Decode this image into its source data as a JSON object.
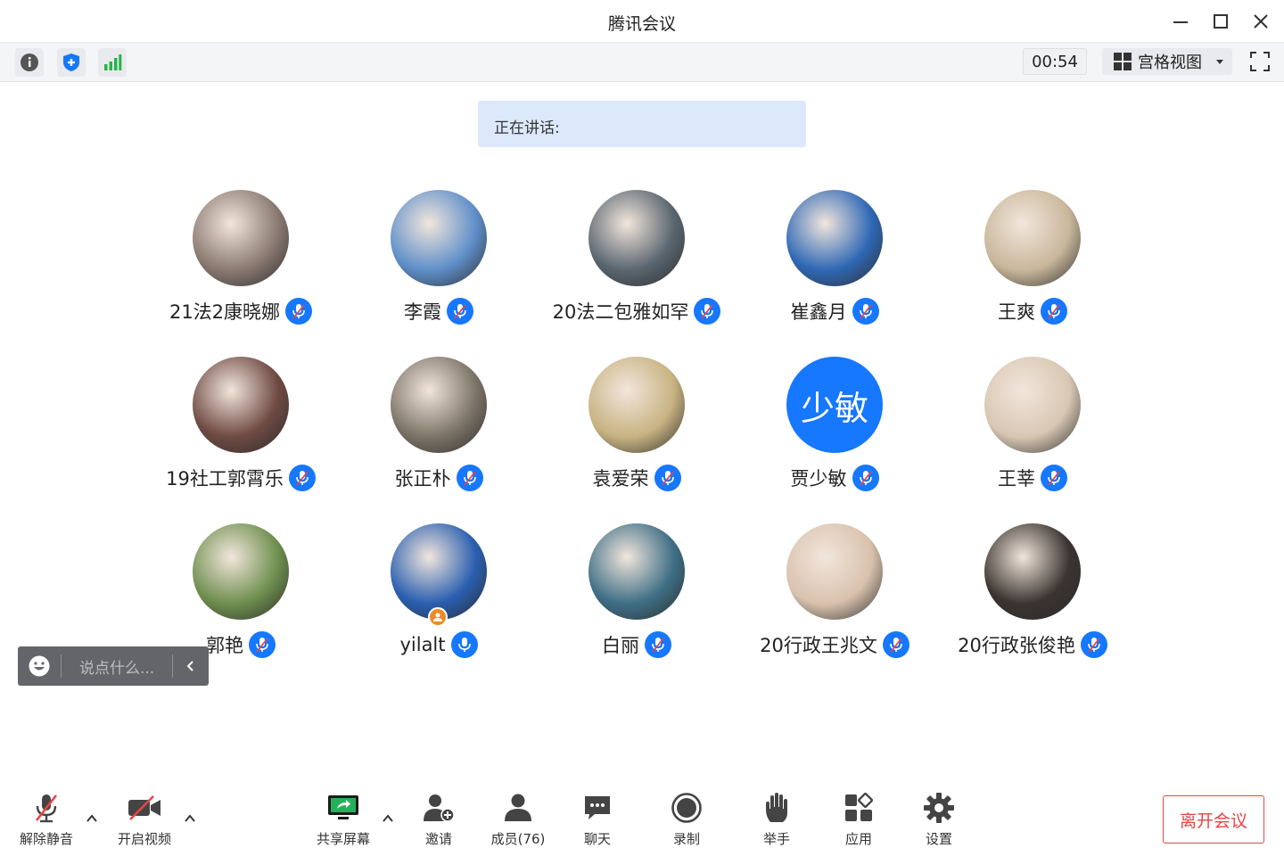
{
  "window": {
    "title": "腾讯会议"
  },
  "toolbar": {
    "timer": "00:54",
    "view_label": "宫格视图",
    "icons": [
      "info-icon",
      "shield-icon",
      "signal-icon",
      "grid-view-icon",
      "fullscreen-icon"
    ]
  },
  "speaking": {
    "label": "正在讲话:"
  },
  "participants": [
    {
      "name": "21法2康晓娜",
      "avatar_color": "#8a7a72"
    },
    {
      "name": "李霞",
      "avatar_color": "#5f8fc9"
    },
    {
      "name": "20法二包雅如罕",
      "avatar_color": "#5a6670"
    },
    {
      "name": "崔鑫月",
      "avatar_color": "#2f68b5"
    },
    {
      "name": "王爽",
      "avatar_color": "#c9b79b"
    },
    {
      "name": "19社工郭霄乐",
      "avatar_color": "#6e4a43"
    },
    {
      "name": "张正朴",
      "avatar_color": "#7d7468"
    },
    {
      "name": "袁爱荣",
      "avatar_color": "#c8b382"
    },
    {
      "name": "贾少敏",
      "avatar_text": "少敏",
      "avatar_color": "#1677ff"
    },
    {
      "name": "王莘",
      "avatar_color": "#d8c7b3"
    },
    {
      "name": "郭艳",
      "avatar_color": "#6f8f4f"
    },
    {
      "name": "yilalt",
      "avatar_color": "#2a5fb0",
      "host": true
    },
    {
      "name": "白丽",
      "avatar_color": "#3f6f86"
    },
    {
      "name": "20行政王兆文",
      "avatar_color": "#d9c2ad"
    },
    {
      "name": "20行政张俊艳",
      "avatar_color": "#3b3430"
    }
  ],
  "chat": {
    "placeholder": "说点什么..."
  },
  "controls": {
    "unmute": "解除静音",
    "start_video": "开启视频",
    "share_screen": "共享屏幕",
    "invite": "邀请",
    "members": "成员(76)",
    "chat": "聊天",
    "record": "录制",
    "raise_hand": "举手",
    "apps": "应用",
    "settings": "设置",
    "leave": "离开会议"
  },
  "colors": {
    "accent": "#1677ff",
    "danger": "#e54545",
    "signal": "#27b34a",
    "host": "#f08a24"
  }
}
